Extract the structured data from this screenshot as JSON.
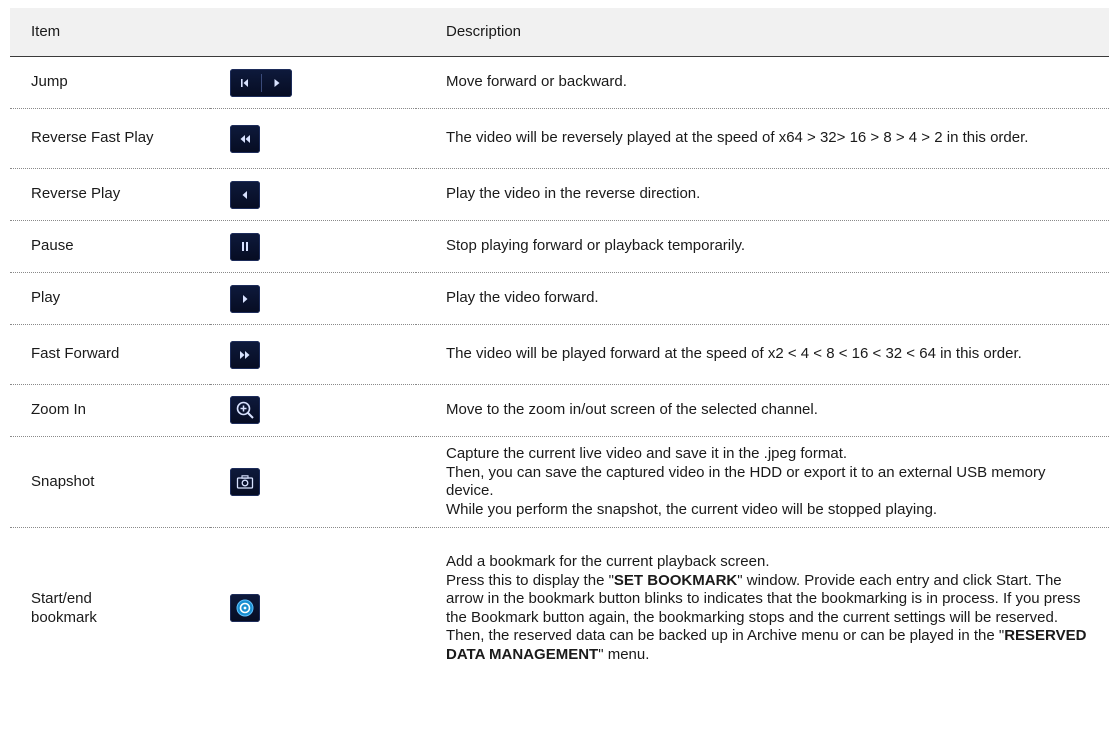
{
  "header": {
    "item": "Item",
    "description": "Description"
  },
  "rows": [
    {
      "item": "Jump",
      "icon": "jump-back-forward-icon",
      "desc": [
        "Move forward or backward."
      ]
    },
    {
      "item": "Reverse Fast Play",
      "icon": "rewind-icon",
      "desc": [
        "The video will be reversely played at the speed of x64 > 32> 16 > 8 > 4 > 2 in this order."
      ]
    },
    {
      "item": "Reverse Play",
      "icon": "reverse-play-icon",
      "desc": [
        "Play the video in the reverse direction."
      ]
    },
    {
      "item": "Pause",
      "icon": "pause-icon",
      "desc": [
        "Stop playing forward or playback temporarily."
      ]
    },
    {
      "item": "Play",
      "icon": "play-icon",
      "desc": [
        "Play the video forward."
      ]
    },
    {
      "item": "Fast Forward",
      "icon": "fast-forward-icon",
      "desc": [
        "The video will be played forward at the speed of x2 < 4 < 8 < 16 < 32 < 64 in this order."
      ]
    },
    {
      "item": "Zoom In",
      "icon": "zoom-in-icon",
      "desc": [
        "Move to the zoom in/out screen of the selected channel."
      ]
    },
    {
      "item": "Snapshot",
      "icon": "camera-icon",
      "desc": [
        "Capture the current live video and save it in the .jpeg format.",
        "Then, you can save the captured video in the HDD or export it to an external USB memory device.",
        "While you perform the snapshot, the current video will be stopped playing."
      ]
    },
    {
      "item": "Start/end bookmark",
      "icon": "bookmark-icon",
      "desc": [
        "Add a bookmark for the current playback screen.",
        "Press this to display the \"",
        "SET BOOKMARK",
        "\" window. Provide each entry and click Start. The arrow in the bookmark button blinks to indicates that the bookmarking is in process. If you press the Bookmark button again, the bookmarking stops and the current settings will be reserved.",
        "Then, the reserved data can be backed up in Archive menu or can be played in the \"",
        "RESERVED DATA MANAGEMENT",
        "\" menu."
      ]
    }
  ]
}
